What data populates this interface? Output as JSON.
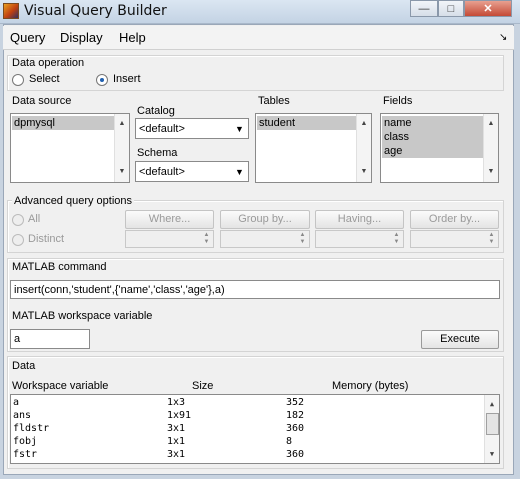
{
  "window": {
    "title": "Visual Query Builder",
    "minimize": "—",
    "maximize": "□",
    "close": "✕"
  },
  "menu": {
    "items": [
      "Query",
      "Display",
      "Help"
    ],
    "pin": "↘"
  },
  "data_operation": {
    "label": "Data operation",
    "select_label": "Select",
    "insert_label": "Insert",
    "selected": "Insert"
  },
  "data_source": {
    "label": "Data source",
    "items": [
      "dpmysql"
    ]
  },
  "catalog": {
    "label": "Catalog",
    "value": "<default>"
  },
  "schema": {
    "label": "Schema",
    "value": "<default>"
  },
  "tables": {
    "label": "Tables",
    "items": [
      "student"
    ]
  },
  "fields": {
    "label": "Fields",
    "items": [
      "name",
      "class",
      "age"
    ]
  },
  "advanced": {
    "label": "Advanced query options",
    "all_label": "All",
    "distinct_label": "Distinct",
    "where": "Where...",
    "group_by": "Group by...",
    "having": "Having...",
    "order_by": "Order by..."
  },
  "matlab_command": {
    "label": "MATLAB command",
    "value": "insert(conn,'student',{'name','class','age'},a)"
  },
  "workspace_variable": {
    "label": "MATLAB workspace variable",
    "value": "a",
    "execute_label": "Execute"
  },
  "data": {
    "label": "Data",
    "headers": [
      "Workspace variable",
      "Size",
      "Memory (bytes)"
    ],
    "rows": [
      [
        "a",
        "1x3",
        "352"
      ],
      [
        "ans",
        "1x91",
        "182"
      ],
      [
        "fldstr",
        "3x1",
        "360"
      ],
      [
        "fobj",
        "1x1",
        "8"
      ],
      [
        "fstr",
        "3x1",
        "360"
      ]
    ]
  }
}
